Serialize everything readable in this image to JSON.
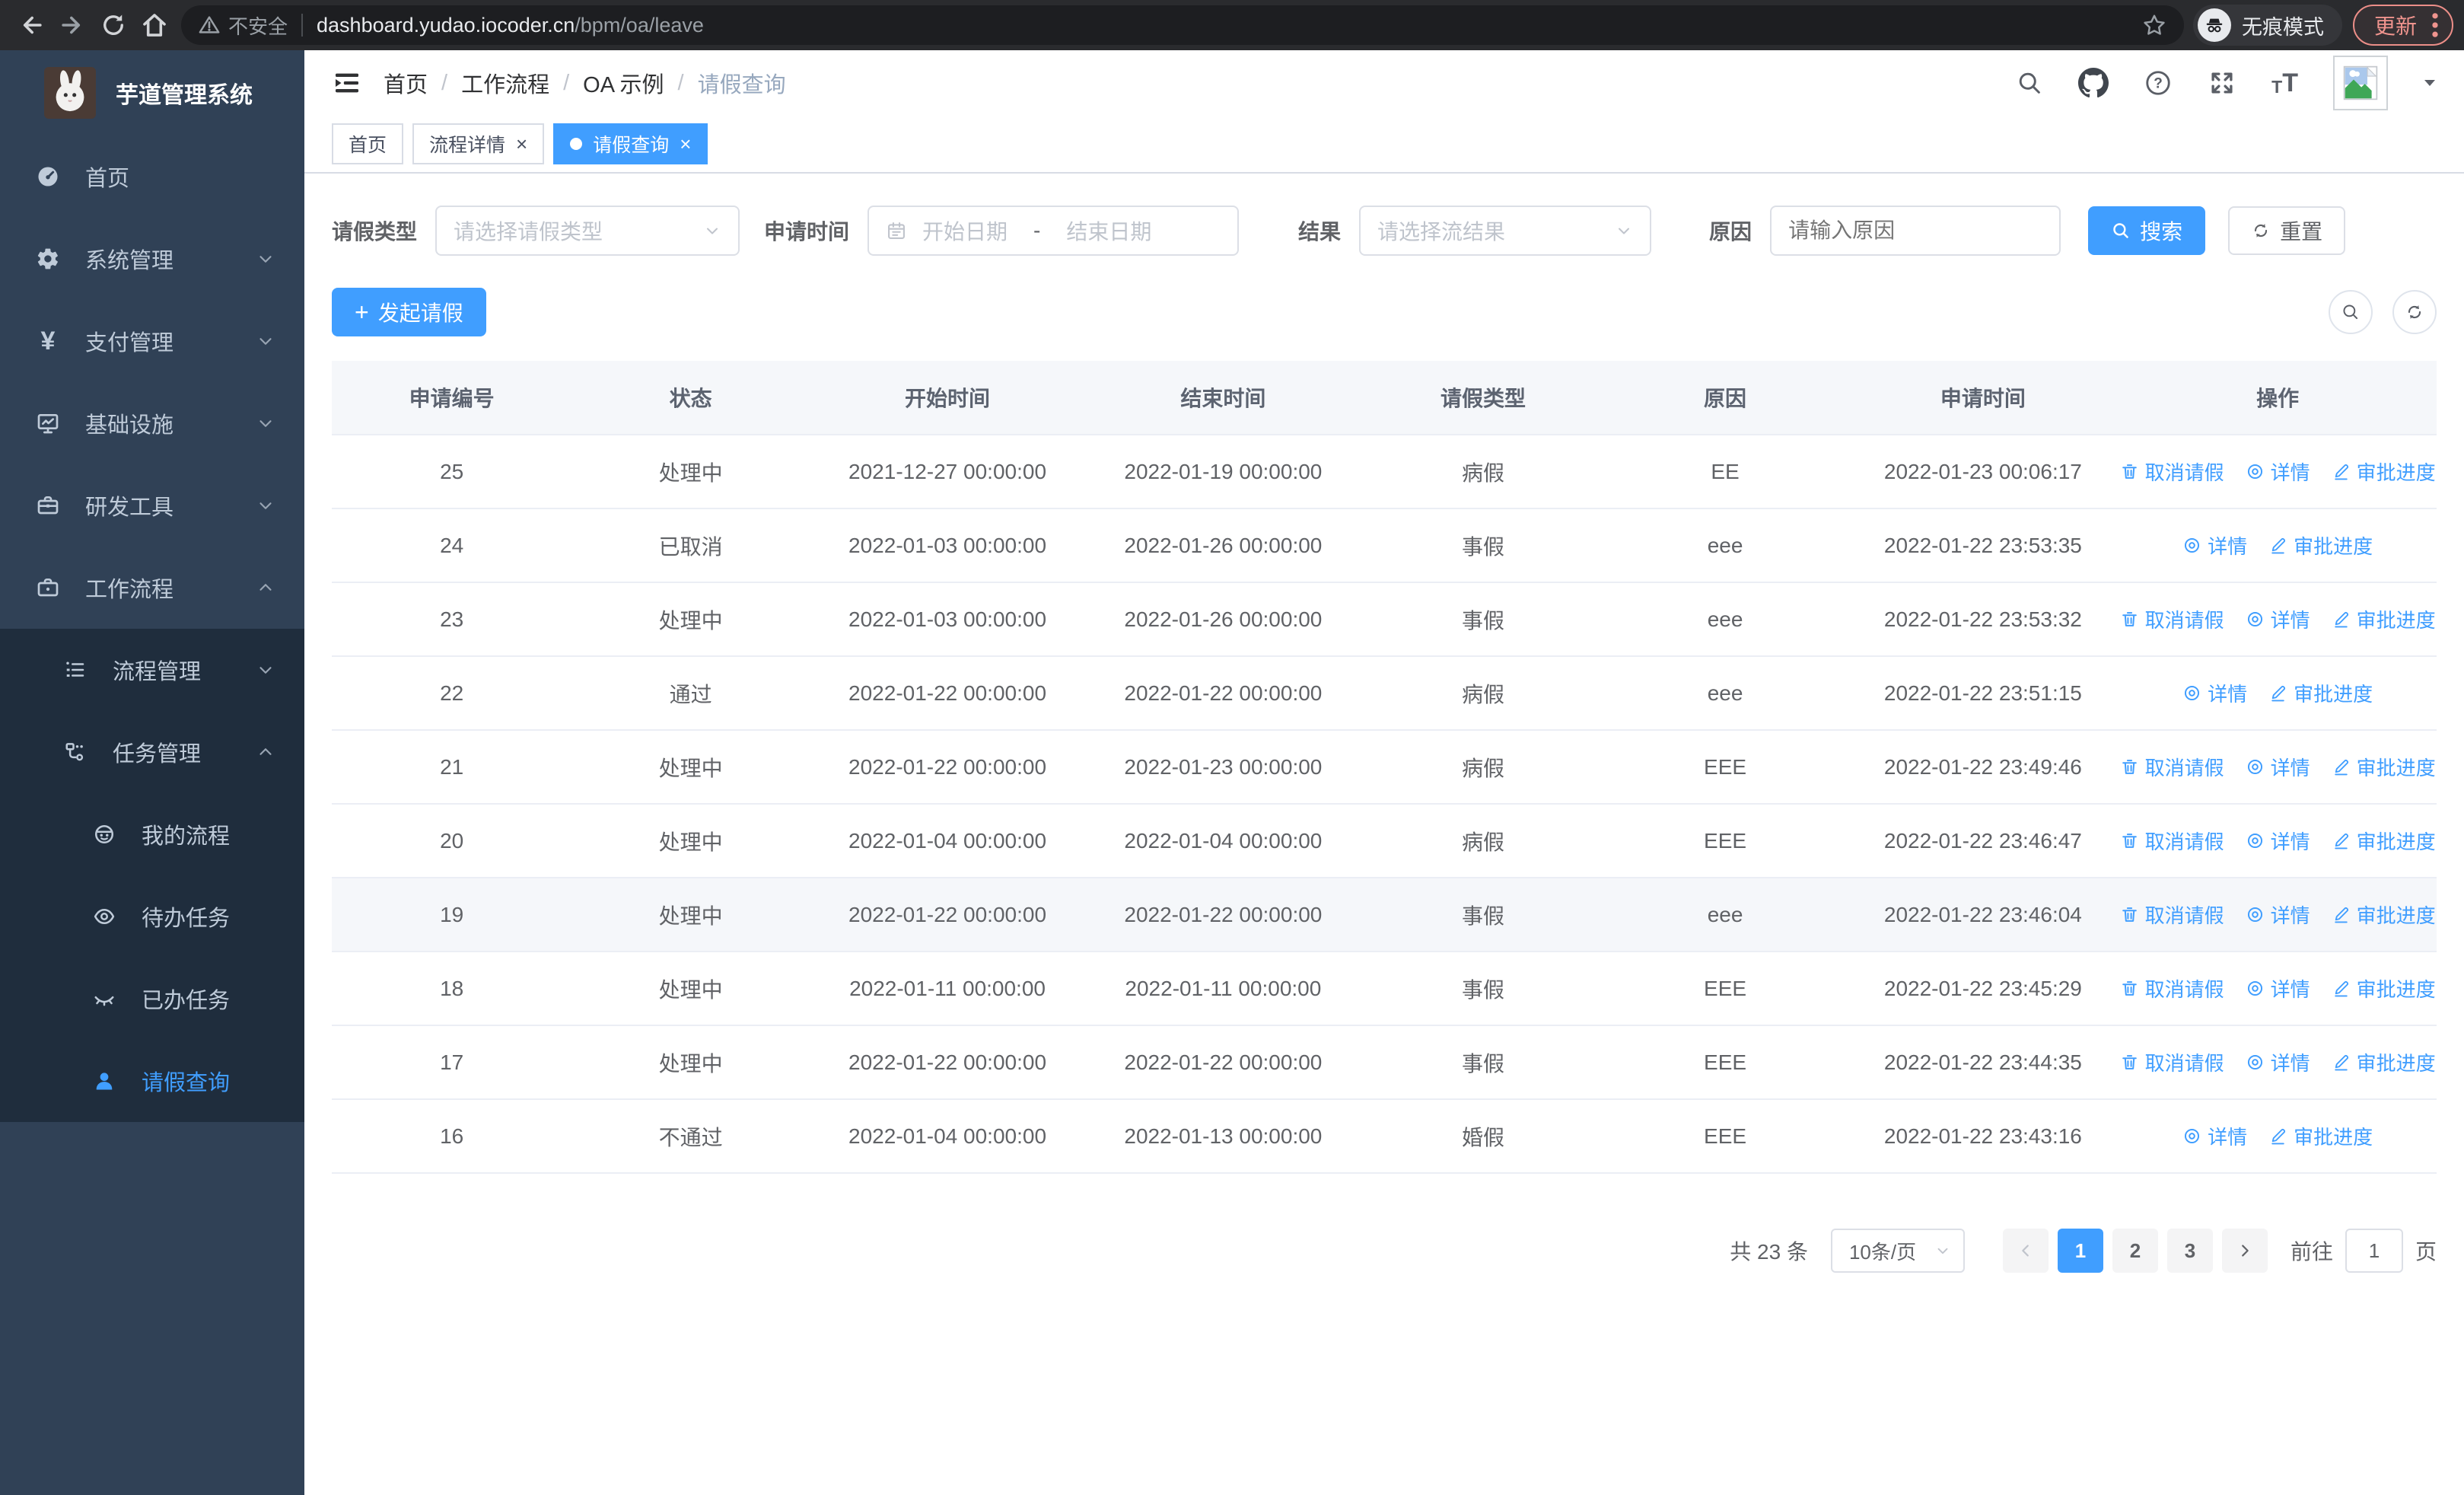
{
  "chrome": {
    "security_label": "不安全",
    "url_domain": "dashboard.yudao.iocoder.cn",
    "url_path": "/bpm/oa/leave",
    "incognito_label": "无痕模式",
    "update_label": "更新"
  },
  "sidebar": {
    "title": "芋道管理系统",
    "items": [
      {
        "label": "首页"
      },
      {
        "label": "系统管理"
      },
      {
        "label": "支付管理"
      },
      {
        "label": "基础设施"
      },
      {
        "label": "研发工具"
      },
      {
        "label": "工作流程"
      },
      {
        "label": "流程管理"
      },
      {
        "label": "任务管理"
      },
      {
        "label": "我的流程"
      },
      {
        "label": "待办任务"
      },
      {
        "label": "已办任务"
      },
      {
        "label": "请假查询"
      }
    ]
  },
  "header": {
    "breadcrumb": [
      "首页",
      "工作流程",
      "OA 示例",
      "请假查询"
    ],
    "separator": "/"
  },
  "tabs": [
    {
      "label": "首页"
    },
    {
      "label": "流程详情"
    },
    {
      "label": "请假查询"
    }
  ],
  "filters": {
    "leave_type_label": "请假类型",
    "leave_type_placeholder": "请选择请假类型",
    "apply_time_label": "申请时间",
    "start_date_placeholder": "开始日期",
    "date_separator": "-",
    "end_date_placeholder": "结束日期",
    "result_label": "结果",
    "result_placeholder": "请选择流结果",
    "reason_label": "原因",
    "reason_placeholder": "请输入原因",
    "search_button": "搜索",
    "reset_button": "重置"
  },
  "toolbar": {
    "create_button": "发起请假"
  },
  "table": {
    "columns": [
      "申请编号",
      "状态",
      "开始时间",
      "结束时间",
      "请假类型",
      "原因",
      "申请时间",
      "操作"
    ],
    "action_labels": {
      "cancel": "取消请假",
      "detail": "详情",
      "progress": "审批进度"
    },
    "rows": [
      {
        "id": "25",
        "status": "处理中",
        "start": "2021-12-27 00:00:00",
        "end": "2022-01-19 00:00:00",
        "type": "病假",
        "reason": "EE",
        "apply": "2022-01-23 00:06:17",
        "actions": [
          "cancel",
          "detail",
          "progress"
        ],
        "highlight": false
      },
      {
        "id": "24",
        "status": "已取消",
        "start": "2022-01-03 00:00:00",
        "end": "2022-01-26 00:00:00",
        "type": "事假",
        "reason": "eee",
        "apply": "2022-01-22 23:53:35",
        "actions": [
          "detail",
          "progress"
        ],
        "highlight": false
      },
      {
        "id": "23",
        "status": "处理中",
        "start": "2022-01-03 00:00:00",
        "end": "2022-01-26 00:00:00",
        "type": "事假",
        "reason": "eee",
        "apply": "2022-01-22 23:53:32",
        "actions": [
          "cancel",
          "detail",
          "progress"
        ],
        "highlight": false
      },
      {
        "id": "22",
        "status": "通过",
        "start": "2022-01-22 00:00:00",
        "end": "2022-01-22 00:00:00",
        "type": "病假",
        "reason": "eee",
        "apply": "2022-01-22 23:51:15",
        "actions": [
          "detail",
          "progress"
        ],
        "highlight": false
      },
      {
        "id": "21",
        "status": "处理中",
        "start": "2022-01-22 00:00:00",
        "end": "2022-01-23 00:00:00",
        "type": "病假",
        "reason": "EEE",
        "apply": "2022-01-22 23:49:46",
        "actions": [
          "cancel",
          "detail",
          "progress"
        ],
        "highlight": false
      },
      {
        "id": "20",
        "status": "处理中",
        "start": "2022-01-04 00:00:00",
        "end": "2022-01-04 00:00:00",
        "type": "病假",
        "reason": "EEE",
        "apply": "2022-01-22 23:46:47",
        "actions": [
          "cancel",
          "detail",
          "progress"
        ],
        "highlight": false
      },
      {
        "id": "19",
        "status": "处理中",
        "start": "2022-01-22 00:00:00",
        "end": "2022-01-22 00:00:00",
        "type": "事假",
        "reason": "eee",
        "apply": "2022-01-22 23:46:04",
        "actions": [
          "cancel",
          "detail",
          "progress"
        ],
        "highlight": true
      },
      {
        "id": "18",
        "status": "处理中",
        "start": "2022-01-11 00:00:00",
        "end": "2022-01-11 00:00:00",
        "type": "事假",
        "reason": "EEE",
        "apply": "2022-01-22 23:45:29",
        "actions": [
          "cancel",
          "detail",
          "progress"
        ],
        "highlight": false
      },
      {
        "id": "17",
        "status": "处理中",
        "start": "2022-01-22 00:00:00",
        "end": "2022-01-22 00:00:00",
        "type": "事假",
        "reason": "EEE",
        "apply": "2022-01-22 23:44:35",
        "actions": [
          "cancel",
          "detail",
          "progress"
        ],
        "highlight": false
      },
      {
        "id": "16",
        "status": "不通过",
        "start": "2022-01-04 00:00:00",
        "end": "2022-01-13 00:00:00",
        "type": "婚假",
        "reason": "EEE",
        "apply": "2022-01-22 23:43:16",
        "actions": [
          "detail",
          "progress"
        ],
        "highlight": false
      }
    ]
  },
  "pagination": {
    "total": "共 23 条",
    "page_size": "10条/页",
    "pages": [
      "1",
      "2",
      "3"
    ],
    "active_page": "1",
    "goto_label": "前往",
    "goto_value": "1",
    "page_unit": "页"
  },
  "colors": {
    "accent": "#409eff",
    "sidebar_bg": "#304156",
    "submenu_bg": "#1f2d3d",
    "update_chip": "#f0948e"
  }
}
